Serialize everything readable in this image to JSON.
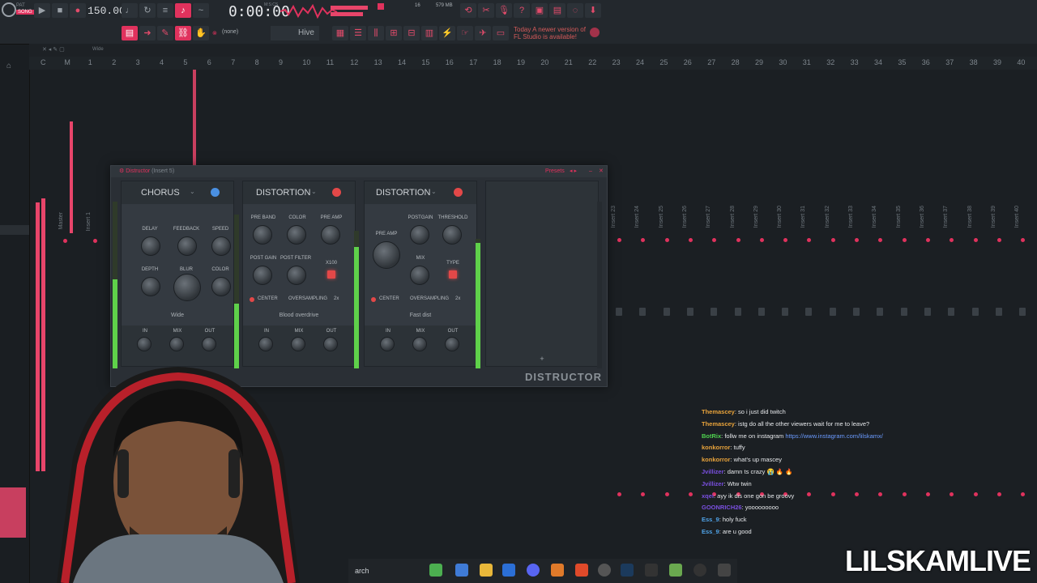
{
  "toolbar": {
    "song_label": "SONG",
    "pat_label": "PAT",
    "tempo": "150.000",
    "time": "0:00:00",
    "time_unit": "M:S:CS",
    "cpu_value": "16",
    "mem_value": "579 MB",
    "preset_none": "(none)",
    "snap": "Hive",
    "notice_line1": "Today  A newer version of",
    "notice_line2": "FL Studio is available!"
  },
  "playlist": {
    "wide_label": "Wide",
    "ruler": [
      "C",
      "M",
      "1",
      "2",
      "3",
      "4",
      "5",
      "6",
      "7",
      "8",
      "9",
      "10",
      "11",
      "12",
      "13",
      "14",
      "15",
      "16",
      "17",
      "18",
      "19",
      "20",
      "21",
      "22",
      "23",
      "24",
      "25",
      "26",
      "27",
      "28",
      "29",
      "30",
      "31",
      "32",
      "33",
      "34",
      "35",
      "36",
      "37",
      "38",
      "39",
      "40"
    ]
  },
  "mixer": {
    "master_label": "Master",
    "insert1_label": "Insert 1",
    "right_inserts": [
      "Insert 23",
      "Insert 24",
      "Insert 25",
      "Insert 26",
      "Insert 27",
      "Insert 28",
      "Insert 29",
      "Insert 30",
      "Insert 31",
      "Insert 32",
      "Insert 33",
      "Insert 34",
      "Insert 35",
      "Insert 36",
      "Insert 37",
      "Insert 38",
      "Insert 39",
      "Insert 40"
    ]
  },
  "plugin": {
    "title": "Distructor",
    "subtitle": "(Insert 5)",
    "presets_label": "Presets",
    "brand": "DISTRUCTOR",
    "modules": [
      {
        "name": "CHORUS",
        "knobs": [
          "DELAY",
          "FEEDBACK",
          "SPEED",
          "DEPTH",
          "BLUR",
          "COLOR"
        ],
        "mode": "Wide",
        "io": [
          "IN",
          "MIX",
          "OUT"
        ]
      },
      {
        "name": "DISTORTION",
        "knobs": [
          "PRE BAND",
          "COLOR",
          "PRE AMP",
          "POST GAIN",
          "POST FILTER"
        ],
        "x100_label": "X100",
        "center_label": "CENTER",
        "oversampling_label": "OVERSAMPLING",
        "oversampling_value": "2x",
        "mode": "Blood overdrive",
        "io": [
          "IN",
          "MIX",
          "OUT"
        ]
      },
      {
        "name": "DISTORTION",
        "knobs": [
          "PRE AMP",
          "POSTGAIN",
          "THRESHOLD",
          "MIX"
        ],
        "type_label": "TYPE",
        "center_label": "CENTER",
        "oversampling_label": "OVERSAMPLING",
        "oversampling_value": "2x",
        "mode": "Fast dist",
        "io": [
          "IN",
          "MIX",
          "OUT"
        ]
      }
    ],
    "add_slot": "+"
  },
  "chat": [
    {
      "user": "Themascey",
      "color": "#e8a33b",
      "text": ": so i just did twitch",
      "link": ""
    },
    {
      "user": "Themascey",
      "color": "#e8a33b",
      "text": ": istg do all the other viewers wait for me to leave?",
      "link": ""
    },
    {
      "user": "BotRix",
      "color": "#4fd34f",
      "text": ": follw me on instagram ",
      "link": "https://www.instagram.com/lilskamx/"
    },
    {
      "user": "konkorror",
      "color": "#e8a33b",
      "text": ": tuffy",
      "link": ""
    },
    {
      "user": "konkorror",
      "color": "#e8a33b",
      "text": ": what's up mascey",
      "link": ""
    },
    {
      "user": "Jvillizer",
      "color": "#7a4fe0",
      "text": ": damn ts crazy 😭 🔥 🔥",
      "link": ""
    },
    {
      "user": "Jvillizer",
      "color": "#7a4fe0",
      "text": ": Wtw twin",
      "link": ""
    },
    {
      "user": "xqei",
      "color": "#7a4fe0",
      "text": ": ayy ik dis one gon be groovy",
      "link": ""
    },
    {
      "user": "GOONRICH26",
      "color": "#7a4fe0",
      "text": ": yooooooooo",
      "link": ""
    },
    {
      "user": "Ess_9",
      "color": "#4fa3e8",
      "text": ": holy fuck",
      "link": ""
    },
    {
      "user": "Ess_9",
      "color": "#4fa3e8",
      "text": ": are u good",
      "link": ""
    }
  ],
  "taskbar": {
    "search_text": "arch"
  },
  "watermark": "LILSKAMLIVE",
  "colors": {
    "accent": "#e0325d",
    "meter_green": "#5fd14a",
    "led_red": "#e34848"
  }
}
